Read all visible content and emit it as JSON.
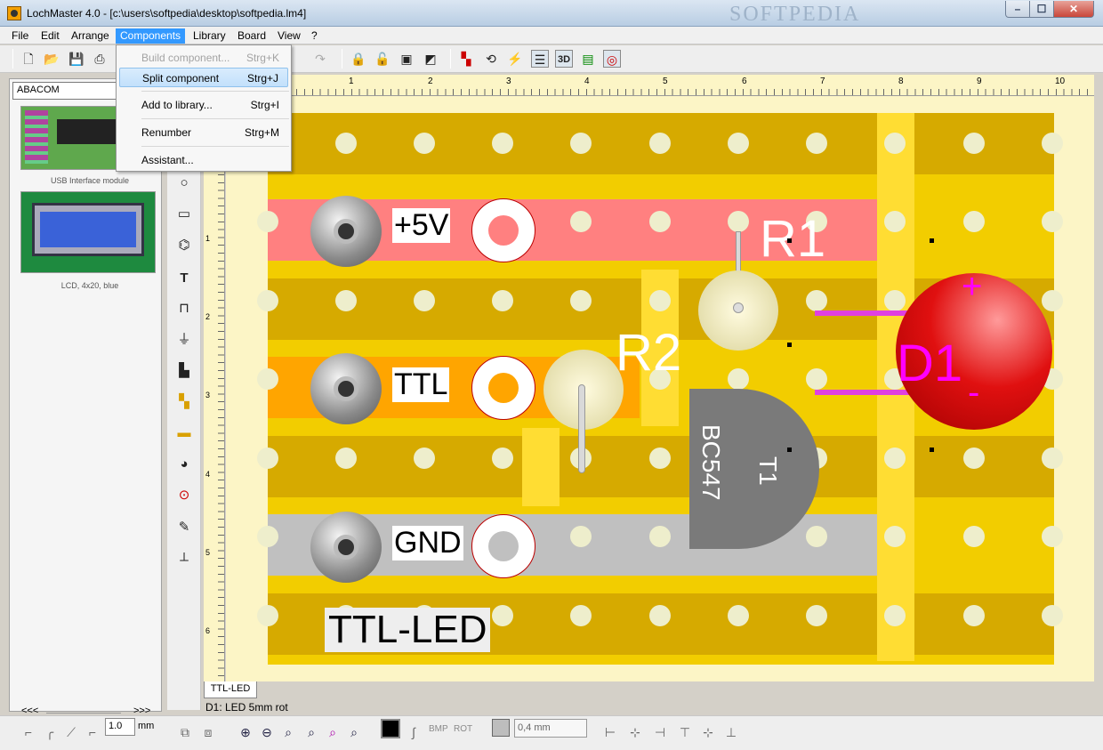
{
  "window": {
    "title": "LochMaster 4.0 - [c:\\users\\softpedia\\desktop\\softpedia.lm4]",
    "watermark": "SOFTPEDIA",
    "controls": {
      "minimize": "–",
      "maximize": "☐",
      "close": "✕"
    }
  },
  "menubar": [
    "File",
    "Edit",
    "Arrange",
    "Components",
    "Library",
    "Board",
    "View",
    "?"
  ],
  "active_menu": "Components",
  "components_menu": {
    "items": [
      {
        "label": "Build component...",
        "shortcut": "Strg+K",
        "disabled": true
      },
      {
        "label": "Split component",
        "shortcut": "Strg+J",
        "highlighted": true
      },
      {
        "label": "Add to library...",
        "shortcut": "Strg+I"
      },
      {
        "label": "Renumber",
        "shortcut": "Strg+M"
      },
      {
        "label": "Assistant...",
        "shortcut": ""
      }
    ]
  },
  "toolbar": {
    "icons": [
      "new-file-icon",
      "open-folder-icon",
      "save-icon",
      "print-icon",
      "redo-icon",
      "lock-icon",
      "unlock-icon",
      "bring-front-icon",
      "send-back-icon",
      "color-icon",
      "rotate-icon",
      "probe-icon",
      "strips-icon",
      "3d-view-icon",
      "grid-icon",
      "target-icon"
    ],
    "view_3d_label": "3D"
  },
  "library": {
    "selected": "ABACOM",
    "items": [
      {
        "label": "USB Interface module"
      },
      {
        "label": "LCD, 4x20, blue"
      }
    ],
    "nav_prev": "<<<",
    "nav_next": ">>>"
  },
  "ruler": {
    "top": [
      "1",
      "2",
      "3",
      "4",
      "5",
      "6",
      "7",
      "8",
      "9",
      "10"
    ],
    "left": [
      "1",
      "2",
      "3",
      "4",
      "5",
      "6"
    ]
  },
  "board": {
    "labels": {
      "plus5v": "+5V",
      "ttl": "TTL",
      "gnd": "GND",
      "title": "TTL-LED"
    },
    "components": {
      "r1": "R1",
      "r2": "R2",
      "d1": "D1",
      "d1_plus": "+",
      "d1_minus": "-",
      "t1": "T1",
      "bc547": "BC547"
    },
    "strip_colors": {
      "plus5v": "#ff8080",
      "ttl": "#ffa500",
      "gnd": "#c0c0c0"
    }
  },
  "sheet_tab": "TTL-LED",
  "status": "D1: LED 5mm rot",
  "bottombar": {
    "line_width": "1.0",
    "unit": "mm",
    "bmp_label": "BMP",
    "rot_label": "ROT",
    "size_value": "0,4 mm"
  }
}
